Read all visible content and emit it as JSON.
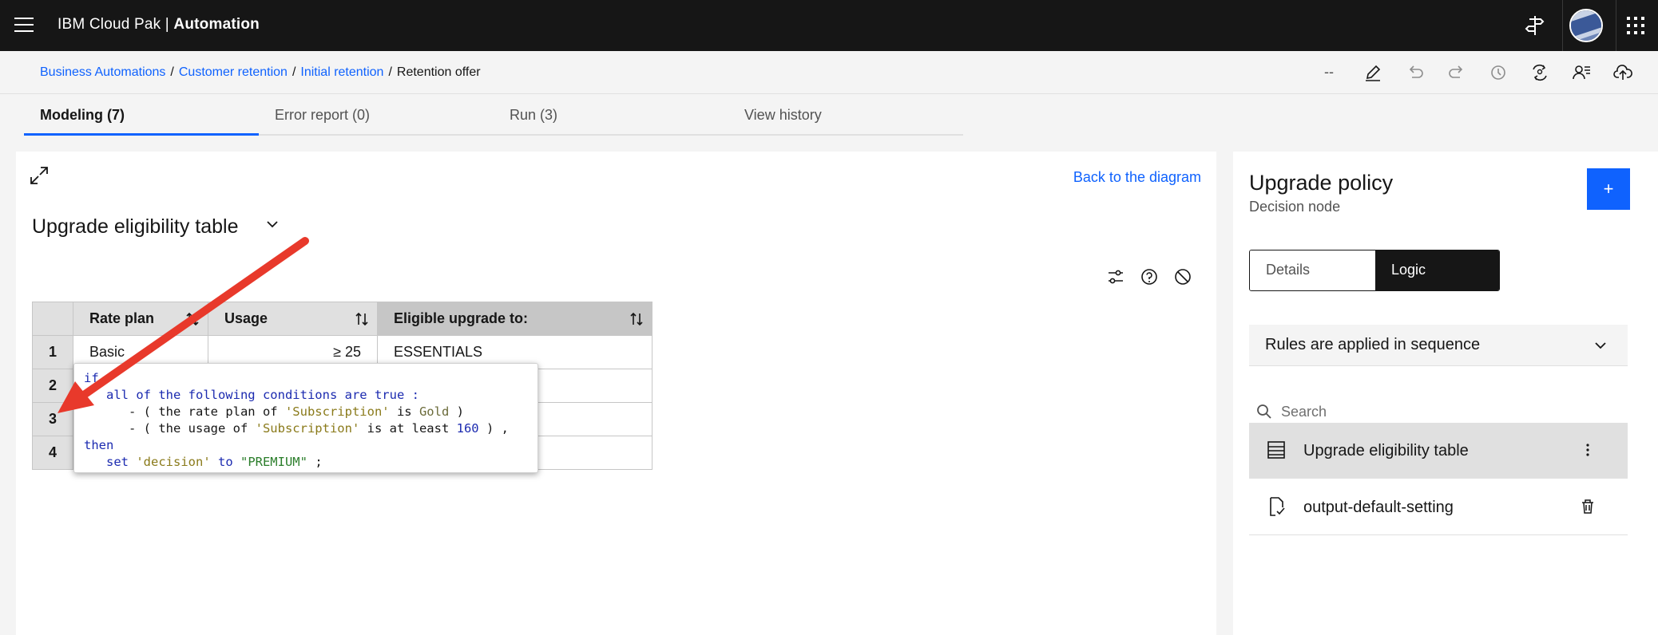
{
  "header": {
    "product_prefix": "IBM Cloud Pak | ",
    "product_name": "Automation",
    "icons": [
      "menu-icon",
      "signpost-icon",
      "user-avatar",
      "app-switcher-icon"
    ]
  },
  "breadcrumb": {
    "items": [
      "Business Automations",
      "Customer retention",
      "Initial retention"
    ],
    "current": "Retention offer",
    "separator": "/"
  },
  "toolbar": {
    "dash_label": "--",
    "icons": [
      "edit-icon",
      "undo-icon",
      "redo-icon",
      "history-icon",
      "compare-icon",
      "user-list-icon",
      "upload-cloud-icon"
    ]
  },
  "tabs": [
    {
      "label": "Modeling (7)",
      "active": true
    },
    {
      "label": "Error report (0)",
      "active": false
    },
    {
      "label": "Run (3)",
      "active": false
    },
    {
      "label": "View history",
      "active": false
    }
  ],
  "main": {
    "back_link": "Back to the diagram",
    "table_title": "Upgrade eligibility table",
    "columns": [
      "Rate plan",
      "Usage",
      "Eligible upgrade to:"
    ],
    "rows": [
      {
        "index": "1",
        "rate_plan": "Basic",
        "usage": "≥ 25",
        "upgrade": "ESSENTIALS"
      },
      {
        "index": "2",
        "rate_plan": "",
        "usage": "",
        "upgrade": ""
      },
      {
        "index": "3",
        "rate_plan": "",
        "usage": "",
        "upgrade": ""
      },
      {
        "index": "4",
        "rate_plan": "",
        "usage": "",
        "upgrade": ""
      }
    ]
  },
  "popup": {
    "line1_kw": "if",
    "line2_kw": "all of the following conditions are true :",
    "line3_a": "- ( the rate plan of ",
    "line3_str": "'Subscription'",
    "line3_b": " is ",
    "line3_val": "Gold",
    "line3_c": " )",
    "line4_a": "- ( the usage of ",
    "line4_str": "'Subscription'",
    "line4_b": " is at least ",
    "line4_num": "160",
    "line4_c": " ) ,",
    "line5_kw": "then",
    "line6_kw1": "set ",
    "line6_str": "'decision'",
    "line6_kw2": " to ",
    "line6_val": "\"PREMIUM\"",
    "line6_end": " ;"
  },
  "panel": {
    "title": "Upgrade policy",
    "subtitle": "Decision node",
    "add_label": "+",
    "segments": [
      "Details",
      "Logic"
    ],
    "active_segment": "Logic",
    "sequence_label": "Rules are applied in sequence",
    "search_placeholder": "Search",
    "rules": [
      {
        "label": "Upgrade eligibility table",
        "icon": "table-icon",
        "action": "overflow-menu-icon",
        "selected": true
      },
      {
        "label": "output-default-setting",
        "icon": "rule-doc-icon",
        "action": "trash-icon",
        "selected": false
      }
    ]
  },
  "colors": {
    "accent": "#0f62fe",
    "header_bg": "#161616",
    "annotation_arrow": "#e8392b"
  }
}
